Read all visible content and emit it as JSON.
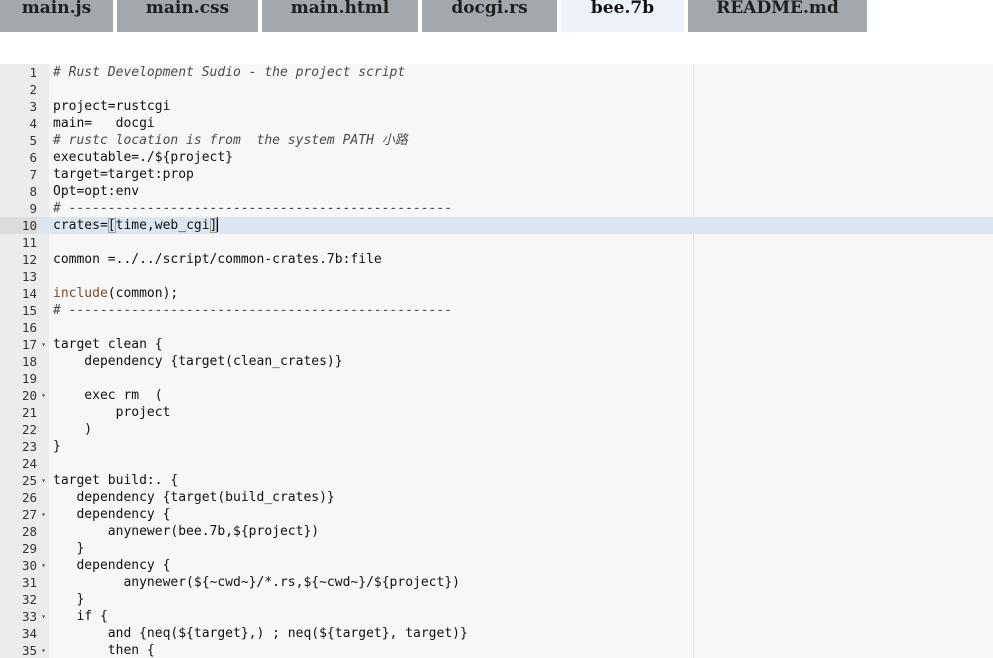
{
  "tabs": [
    {
      "label": "main.js",
      "active": false
    },
    {
      "label": "main.css",
      "active": false
    },
    {
      "label": "main.html",
      "active": false
    },
    {
      "label": "docgi.rs",
      "active": false
    },
    {
      "label": "bee.7b",
      "active": true
    },
    {
      "label": "README.md",
      "active": false
    }
  ],
  "editor": {
    "active_line": 10,
    "lines": [
      {
        "n": "1",
        "text": "# Rust Development Sudio - the project script",
        "fold": false,
        "kind": "comment"
      },
      {
        "n": "2",
        "text": "",
        "fold": false,
        "kind": "plain"
      },
      {
        "n": "3",
        "text": "project=rustcgi",
        "fold": false,
        "kind": "plain"
      },
      {
        "n": "4",
        "text": "main=   docgi",
        "fold": false,
        "kind": "plain"
      },
      {
        "n": "5",
        "text": "# rustc location is from  the system PATH 小路",
        "fold": false,
        "kind": "comment"
      },
      {
        "n": "6",
        "text": "executable=./${project}",
        "fold": false,
        "kind": "plain"
      },
      {
        "n": "7",
        "text": "target=target:prop",
        "fold": false,
        "kind": "plain"
      },
      {
        "n": "8",
        "text": "Opt=opt:env",
        "fold": false,
        "kind": "plain"
      },
      {
        "n": "9",
        "text": "# -------------------------------------------------",
        "fold": false,
        "kind": "comment"
      },
      {
        "n": "10",
        "text": "",
        "fold": false,
        "kind": "active",
        "parts": [
          "crates=",
          "[",
          "time,web_cgi",
          "]"
        ]
      },
      {
        "n": "11",
        "text": "",
        "fold": false,
        "kind": "plain"
      },
      {
        "n": "12",
        "text": "common =../../script/common-crates.7b:file",
        "fold": false,
        "kind": "plain"
      },
      {
        "n": "13",
        "text": "",
        "fold": false,
        "kind": "plain"
      },
      {
        "n": "14",
        "text": "",
        "fold": false,
        "kind": "include",
        "parts": [
          "include",
          "(common);"
        ]
      },
      {
        "n": "15",
        "text": "# -------------------------------------------------",
        "fold": false,
        "kind": "comment"
      },
      {
        "n": "16",
        "text": "",
        "fold": false,
        "kind": "plain"
      },
      {
        "n": "17",
        "text": "target clean {",
        "fold": true,
        "kind": "plain"
      },
      {
        "n": "18",
        "text": "    dependency {target(clean_crates)}",
        "fold": false,
        "kind": "plain"
      },
      {
        "n": "19",
        "text": "",
        "fold": false,
        "kind": "plain"
      },
      {
        "n": "20",
        "text": "    exec rm  (",
        "fold": true,
        "kind": "plain"
      },
      {
        "n": "21",
        "text": "        project",
        "fold": false,
        "kind": "plain"
      },
      {
        "n": "22",
        "text": "    )",
        "fold": false,
        "kind": "plain"
      },
      {
        "n": "23",
        "text": "}",
        "fold": false,
        "kind": "plain"
      },
      {
        "n": "24",
        "text": "",
        "fold": false,
        "kind": "plain"
      },
      {
        "n": "25",
        "text": "target build:. {",
        "fold": true,
        "kind": "plain"
      },
      {
        "n": "26",
        "text": "   dependency {target(build_crates)}",
        "fold": false,
        "kind": "plain"
      },
      {
        "n": "27",
        "text": "   dependency {",
        "fold": true,
        "kind": "plain"
      },
      {
        "n": "28",
        "text": "       anynewer(bee.7b,${project})",
        "fold": false,
        "kind": "plain"
      },
      {
        "n": "29",
        "text": "   }",
        "fold": false,
        "kind": "plain"
      },
      {
        "n": "30",
        "text": "   dependency {",
        "fold": true,
        "kind": "plain"
      },
      {
        "n": "31",
        "text": "         anynewer(${~cwd~}/*.rs,${~cwd~}/${project})",
        "fold": false,
        "kind": "plain"
      },
      {
        "n": "32",
        "text": "   }",
        "fold": false,
        "kind": "plain"
      },
      {
        "n": "33",
        "text": "   if {",
        "fold": true,
        "kind": "plain"
      },
      {
        "n": "34",
        "text": "       and {neq(${target},) ; neq(${target}, target)}",
        "fold": false,
        "kind": "plain"
      },
      {
        "n": "35",
        "text": "       then {",
        "fold": true,
        "kind": "plain"
      }
    ]
  },
  "icons": {
    "fold": "fold-arrow-down-icon"
  },
  "colors": {
    "tab_bg": "#a3a8ad",
    "tab_active_bg": "#eef3fb",
    "gutter_bg": "#ececec",
    "active_line_bg": "#dce6f0",
    "keyword": "#7a4a2a"
  }
}
